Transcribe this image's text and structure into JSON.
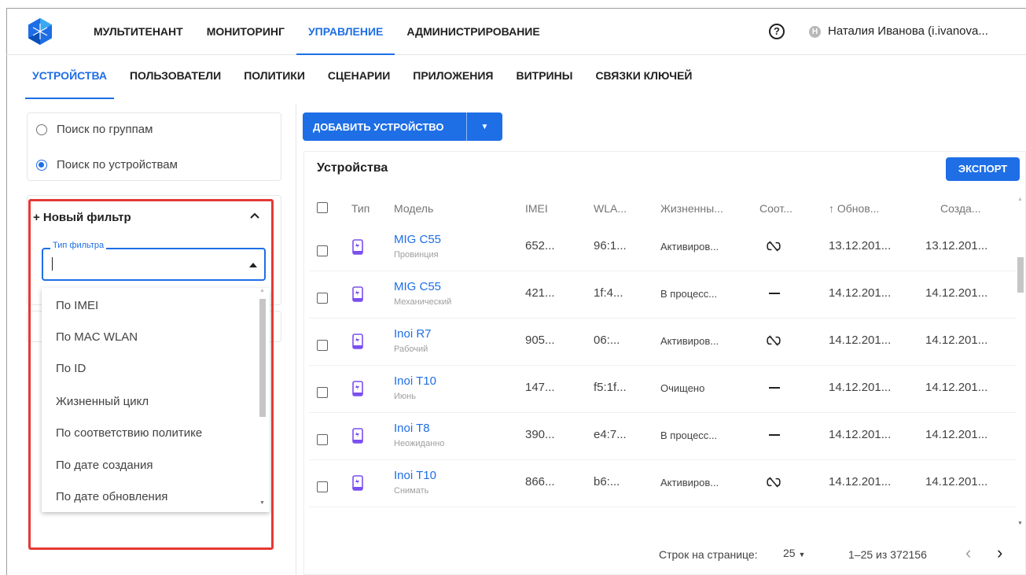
{
  "topnav": {
    "items": [
      "МУЛЬТИТЕНАНТ",
      "МОНИТОРИНГ",
      "УПРАВЛЕНИЕ",
      "АДМИНИСТРИРОВАНИЕ"
    ],
    "active": "УПРАВЛЕНИЕ",
    "help_icon": "?",
    "avatar_initial": "Н",
    "user_name": "Наталия Иванова (i.ivanova..."
  },
  "subnav": {
    "items": [
      "УСТРОЙСТВА",
      "ПОЛЬЗОВАТЕЛИ",
      "ПОЛИТИКИ",
      "СЦЕНАРИИ",
      "ПРИЛОЖЕНИЯ",
      "ВИТРИНЫ",
      "СВЯЗКИ КЛЮЧЕЙ"
    ],
    "active": "УСТРОЙСТВА"
  },
  "search_mode": {
    "options": [
      "Поиск по группам",
      "Поиск по устройствам"
    ],
    "selected": "Поиск по устройствам"
  },
  "filter": {
    "title": "+ Новый фильтр",
    "type_label": "Тип фильтра",
    "type_value": "",
    "options": [
      "По IMEI",
      "По MAC WLAN",
      "По ID",
      "Жизненный цикл",
      "По соответствию политике",
      "По дате создания",
      "По дате обновления"
    ]
  },
  "actions": {
    "add_device": "ДОБАВИТЬ УСТРОЙСТВО",
    "export": "ЭКСПОРТ"
  },
  "table": {
    "title": "Устройства",
    "columns": [
      "Тип",
      "Модель",
      "IMEI",
      "WLA...",
      "Жизненны...",
      "Соот...",
      "↑ Обнов...",
      "Созда..."
    ],
    "rows": [
      {
        "model": "MIG C55",
        "sub": "Провинция",
        "imei": "652...",
        "wlan": "96:1...",
        "lifecycle": "Активиров...",
        "compliance": "unlinked",
        "updated": "13.12.201...",
        "created": "13.12.201..."
      },
      {
        "model": "MIG C55",
        "sub": "Механический",
        "imei": "421...",
        "wlan": "1f:4...",
        "lifecycle": "В процесс...",
        "compliance": "dash",
        "updated": "14.12.201...",
        "created": "14.12.201..."
      },
      {
        "model": "Inoi R7",
        "sub": "Рабочий",
        "imei": "905...",
        "wlan": "06:...",
        "lifecycle": "Активиров...",
        "compliance": "unlinked",
        "updated": "14.12.201...",
        "created": "14.12.201..."
      },
      {
        "model": "Inoi T10",
        "sub": "Июнь",
        "imei": "147...",
        "wlan": "f5:1f...",
        "lifecycle": "Очищено",
        "compliance": "dash",
        "updated": "14.12.201...",
        "created": "14.12.201..."
      },
      {
        "model": "Inoi T8",
        "sub": "Неожиданно",
        "imei": "390...",
        "wlan": "e4:7...",
        "lifecycle": "В процесс...",
        "compliance": "dash",
        "updated": "14.12.201...",
        "created": "14.12.201..."
      },
      {
        "model": "Inoi T10",
        "sub": "Снимать",
        "imei": "866...",
        "wlan": "b6:...",
        "lifecycle": "Активиров...",
        "compliance": "unlinked",
        "updated": "14.12.201...",
        "created": "14.12.201..."
      }
    ]
  },
  "pagination": {
    "rows_label": "Строк на странице:",
    "rows_value": "25",
    "range": "1–25 из 372156",
    "prev_icon": "‹",
    "next_icon": "›"
  },
  "colors": {
    "accent": "#1e6ee6",
    "highlight": "#e53935"
  }
}
